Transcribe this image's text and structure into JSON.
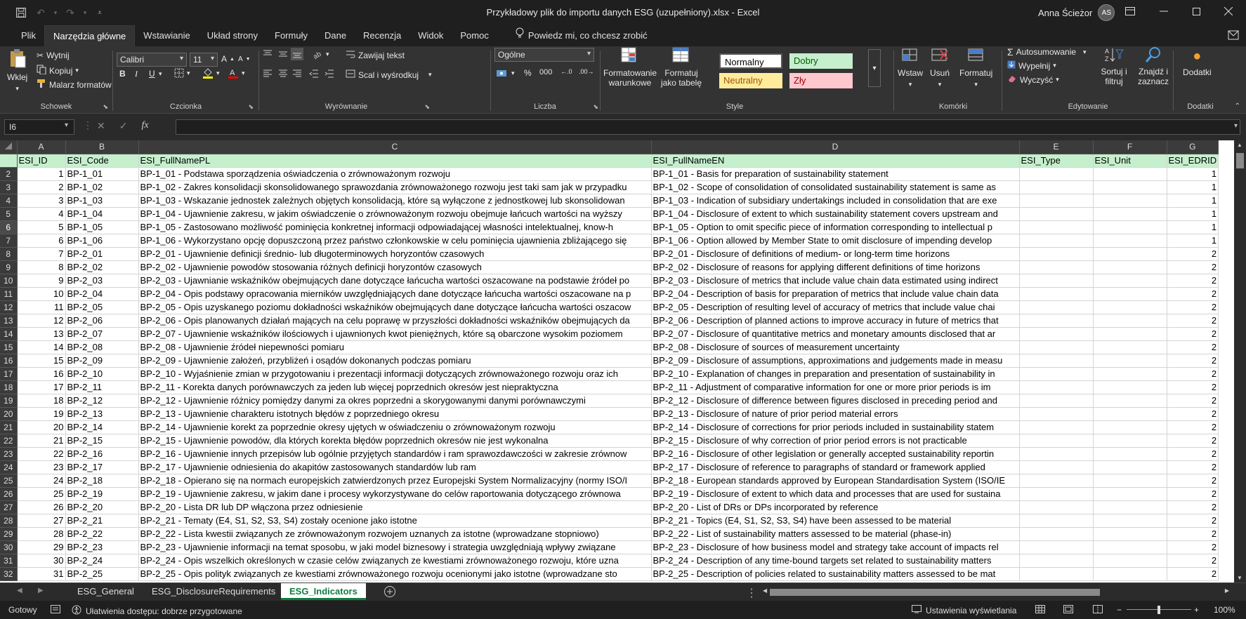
{
  "window": {
    "title": "Przykładowy plik do importu danych ESG (uzupełniony).xlsx  -  Excel",
    "user": "Anna Ścieżor",
    "user_initials": "AS"
  },
  "menu": {
    "tabs": [
      "Plik",
      "Narzędzia główne",
      "Wstawianie",
      "Układ strony",
      "Formuły",
      "Dane",
      "Recenzja",
      "Widok",
      "Pomoc"
    ],
    "tellme": "Powiedz mi, co chcesz zrobić"
  },
  "ribbon": {
    "clipboard": {
      "paste": "Wklej",
      "cut": "Wytnij",
      "copy": "Kopiuj",
      "painter": "Malarz formatów",
      "label": "Schowek"
    },
    "font": {
      "name": "Calibri",
      "size": "11",
      "bold": "B",
      "italic": "I",
      "underline": "U",
      "label": "Czcionka"
    },
    "alignment": {
      "wrap": "Zawijaj tekst",
      "merge": "Scal i wyśrodkuj",
      "label": "Wyrównanie"
    },
    "number": {
      "format": "Ogólne",
      "label": "Liczba"
    },
    "styles": {
      "conditional": "Formatowanie warunkowe",
      "table": "Formatuj jako tabelę",
      "normal": "Normalny",
      "good": "Dobry",
      "neutral": "Neutralny",
      "bad": "Zły",
      "label": "Style"
    },
    "cells": {
      "insert": "Wstaw",
      "delete": "Usuń",
      "format": "Formatuj",
      "label": "Komórki"
    },
    "editing": {
      "autosum": "Autosumowanie",
      "fill": "Wypełnij",
      "clear": "Wyczyść",
      "sort": "Sortuj i filtruj",
      "find": "Znajdź i zaznacz",
      "label": "Edytowanie"
    },
    "addins": {
      "button": "Dodatki",
      "label": "Dodatki"
    }
  },
  "formula": {
    "namebox": "I6",
    "value": ""
  },
  "grid": {
    "columns": [
      "A",
      "B",
      "C",
      "D",
      "E",
      "F",
      "G"
    ],
    "header_row": [
      "ESI_ID",
      "ESI_Code",
      "ESI_FullNamePL",
      "ESI_FullNameEN",
      "ESI_Type",
      "ESI_Unit",
      "ESI_EDRID"
    ],
    "rows": [
      [
        "1",
        "BP-1_01",
        "BP-1_01 - Podstawa sporządzenia oświadczenia o zrównoważonym rozwoju",
        "BP-1_01 - Basis for preparation of sustainability statement",
        "",
        "",
        "1"
      ],
      [
        "2",
        "BP-1_02",
        "BP-1_02 - Zakres konsolidacji skonsolidowanego sprawozdania zrównoważonego rozwoju jest taki sam jak w przypadku",
        "BP-1_02 - Scope of consolidation of consolidated sustainability statement is same as",
        "",
        "",
        "1"
      ],
      [
        "3",
        "BP-1_03",
        "BP-1_03 - Wskazanie jednostek zależnych objętych konsolidacją, które są wyłączone z jednostkowej lub skonsolidowan",
        "BP-1_03 - Indication of subsidiary undertakings included in consolidation that are exe",
        "",
        "",
        "1"
      ],
      [
        "4",
        "BP-1_04",
        "BP-1_04 - Ujawnienie zakresu, w jakim oświadczenie o zrównoważonym rozwoju obejmuje łańcuch wartości na wyższy",
        "BP-1_04 - Disclosure of extent to which sustainability statement covers upstream and",
        "",
        "",
        "1"
      ],
      [
        "5",
        "BP-1_05",
        "BP-1_05 - Zastosowano możliwość pominięcia konkretnej informacji odpowiadającej własności intelektualnej, know-h",
        "BP-1_05 - Option to omit specific piece of information corresponding to intellectual p",
        "",
        "",
        "1"
      ],
      [
        "6",
        "BP-1_06",
        "BP-1_06 - Wykorzystano opcję dopuszczoną przez państwo członkowskie w celu pominięcia ujawnienia zbliżającego się",
        "BP-1_06 - Option allowed by Member State to omit disclosure of impending develop",
        "",
        "",
        "1"
      ],
      [
        "7",
        "BP-2_01",
        "BP-2_01 - Ujawnienie definicji średnio- lub długoterminowych horyzontów czasowych",
        "BP-2_01 - Disclosure of definitions of medium- or long-term time horizons",
        "",
        "",
        "2"
      ],
      [
        "8",
        "BP-2_02",
        "BP-2_02 - Ujawnienie powodów stosowania różnych definicji horyzontów czasowych",
        "BP-2_02 - Disclosure of reasons for applying different definitions of time horizons",
        "",
        "",
        "2"
      ],
      [
        "9",
        "BP-2_03",
        "BP-2_03 - Ujawnianie wskaźników obejmujących dane dotyczące łańcucha wartości oszacowane na podstawie źródeł po",
        "BP-2_03 - Disclosure of metrics that include value chain data estimated using indirect",
        "",
        "",
        "2"
      ],
      [
        "10",
        "BP-2_04",
        "BP-2_04 - Opis podstawy opracowania mierników uwzględniających dane dotyczące łańcucha wartości oszacowane na p",
        "BP-2_04 - Description of basis for preparation of metrics that include value chain data",
        "",
        "",
        "2"
      ],
      [
        "11",
        "BP-2_05",
        "BP-2_05 - Opis uzyskanego poziomu dokładności wskaźników obejmujących dane dotyczące łańcucha wartości oszacow",
        "BP-2_05 - Description of resulting level of accuracy of metrics that include value chai",
        "",
        "",
        "2"
      ],
      [
        "12",
        "BP-2_06",
        "BP-2_06 - Opis planowanych działań mających na celu poprawę w przyszłości dokładności wskaźników obejmujących da",
        "BP-2_06 - Description of planned actions to improve accuracy in future of metrics that",
        "",
        "",
        "2"
      ],
      [
        "13",
        "BP-2_07",
        "BP-2_07 - Ujawnienie wskaźników ilościowych i ujawnionych kwot pieniężnych, które są obarczone wysokim poziomem",
        "BP-2_07 - Disclosure of quantitative metrics and monetary amounts disclosed that ar",
        "",
        "",
        "2"
      ],
      [
        "14",
        "BP-2_08",
        "BP-2_08 - Ujawnienie źródeł niepewności pomiaru",
        "BP-2_08 - Disclosure of sources of measurement uncertainty",
        "",
        "",
        "2"
      ],
      [
        "15",
        "BP-2_09",
        "BP-2_09 - Ujawnienie założeń, przybliżeń i osądów dokonanych podczas pomiaru",
        "BP-2_09 - Disclosure of assumptions, approximations and judgements made in measu",
        "",
        "",
        "2"
      ],
      [
        "16",
        "BP-2_10",
        "BP-2_10 - Wyjaśnienie zmian w przygotowaniu i prezentacji informacji dotyczących zrównoważonego rozwoju oraz ich",
        "BP-2_10 - Explanation of changes in preparation and presentation of sustainability in",
        "",
        "",
        "2"
      ],
      [
        "17",
        "BP-2_11",
        "BP-2_11 - Korekta danych porównawczych za jeden lub więcej poprzednich okresów jest niepraktyczna",
        "BP-2_11 - Adjustment of comparative information for one or more prior periods is im",
        "",
        "",
        "2"
      ],
      [
        "18",
        "BP-2_12",
        "BP-2_12 - Ujawnienie różnicy pomiędzy danymi za okres poprzedni a skorygowanymi danymi porównawczymi",
        "BP-2_12 - Disclosure of difference between figures disclosed in preceding period and",
        "",
        "",
        "2"
      ],
      [
        "19",
        "BP-2_13",
        "BP-2_13 - Ujawnienie charakteru istotnych błędów z poprzedniego okresu",
        "BP-2_13 - Disclosure of nature of prior period material errors",
        "",
        "",
        "2"
      ],
      [
        "20",
        "BP-2_14",
        "BP-2_14 - Ujawnienie korekt za poprzednie okresy ujętych w oświadczeniu o zrównoważonym rozwoju",
        "BP-2_14 - Disclosure of corrections for prior periods included in sustainability statem",
        "",
        "",
        "2"
      ],
      [
        "21",
        "BP-2_15",
        "BP-2_15 - Ujawnienie powodów, dla których korekta błędów poprzednich okresów nie jest wykonalna",
        "BP-2_15 - Disclosure of why correction of prior period errors is not practicable",
        "",
        "",
        "2"
      ],
      [
        "22",
        "BP-2_16",
        "BP-2_16 - Ujawnienie innych przepisów lub ogólnie przyjętych standardów i ram sprawozdawczości w zakresie zrównow",
        "BP-2_16 - Disclosure of other legislation or generally accepted sustainability reportin",
        "",
        "",
        "2"
      ],
      [
        "23",
        "BP-2_17",
        "BP-2_17 - Ujawnienie odniesienia do akapitów zastosowanych standardów lub ram",
        "BP-2_17 - Disclosure of reference to paragraphs of standard or framework applied",
        "",
        "",
        "2"
      ],
      [
        "24",
        "BP-2_18",
        "BP-2_18 - Opierano się na normach europejskich zatwierdzonych przez Europejski System Normalizacyjny (normy ISO/I",
        "BP-2_18 - European standards approved by European Standardisation System (ISO/IE",
        "",
        "",
        "2"
      ],
      [
        "25",
        "BP-2_19",
        "BP-2_19 - Ujawnienie zakresu, w jakim dane i procesy wykorzystywane do celów raportowania dotyczącego zrównowa",
        "BP-2_19 - Disclosure of extent to which data and processes that are used for sustaina",
        "",
        "",
        "2"
      ],
      [
        "26",
        "BP-2_20",
        "BP-2_20 - Lista DR lub DP włączona przez odniesienie",
        "BP-2_20 - List of DRs or DPs incorporated by reference",
        "",
        "",
        "2"
      ],
      [
        "27",
        "BP-2_21",
        "BP-2_21 - Tematy (E4, S1, S2, S3, S4) zostały ocenione jako istotne",
        "BP-2_21 - Topics (E4, S1, S2, S3, S4) have been assessed to be material",
        "",
        "",
        "2"
      ],
      [
        "28",
        "BP-2_22",
        "BP-2_22 - Lista kwestii związanych ze zrównoważonym rozwojem uznanych za istotne (wprowadzane stopniowo)",
        "BP-2_22 - List of sustainability matters assessed to be material (phase-in)",
        "",
        "",
        "2"
      ],
      [
        "29",
        "BP-2_23",
        "BP-2_23 - Ujawnienie informacji na temat sposobu, w jaki model biznesowy i strategia uwzględniają wpływy związane",
        "BP-2_23 - Disclosure of how business model and strategy take account of impacts rel",
        "",
        "",
        "2"
      ],
      [
        "30",
        "BP-2_24",
        "BP-2_24 - Opis wszelkich określonych w czasie celów związanych ze kwestiami zrównoważonego rozwoju, które uzna",
        "BP-2_24 - Description of any time-bound targets set related to sustainability matters",
        "",
        "",
        "2"
      ],
      [
        "31",
        "BP-2_25",
        "BP-2_25 - Opis polityk związanych ze kwestiami zrównoważonego rozwoju ocenionymi jako istotne (wprowadzane sto",
        "BP-2_25 - Description of policies related to sustainability matters assessed to be mat",
        "",
        "",
        "2"
      ]
    ]
  },
  "sheets": {
    "tabs": [
      "ESG_General",
      "ESG_DisclosureRequirements",
      "ESG_Indicators"
    ],
    "active": "ESG_Indicators"
  },
  "status": {
    "ready": "Gotowy",
    "accessibility": "Ułatwienia dostępu: dobrze przygotowane",
    "display": "Ustawienia wyświetlania",
    "zoom": "100%"
  }
}
